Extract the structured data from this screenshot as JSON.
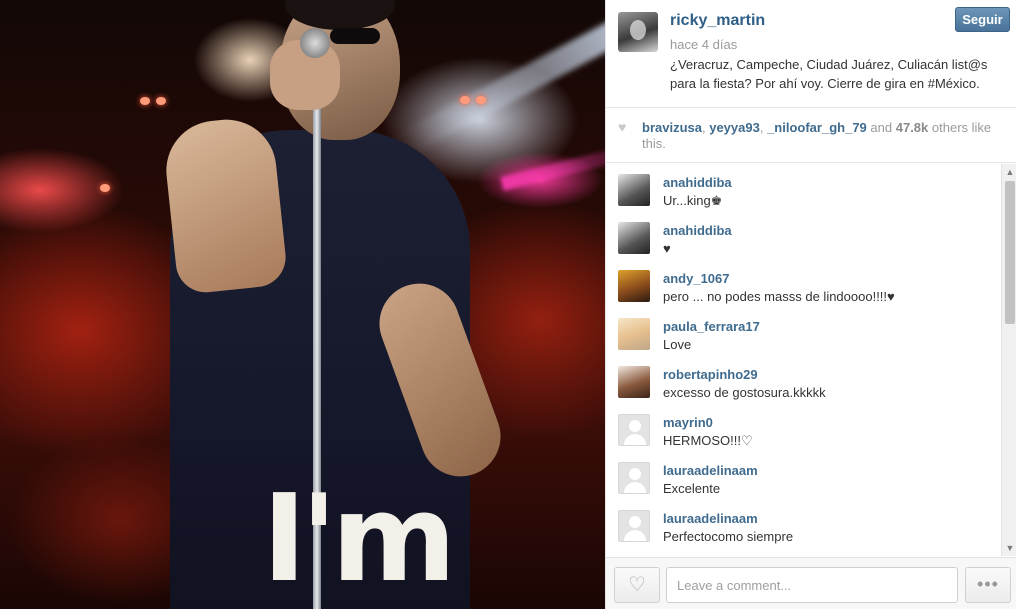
{
  "post": {
    "username": "ricky_martin",
    "time": "hace 4 días",
    "caption": "¿Veracruz, Campeche, Ciudad Juárez, Culiacán list@s para la fiesta? Por ahí voy. Cierre de gira en #México.",
    "follow_label": "Seguir",
    "photo_shirt_text": "I'm"
  },
  "likes": {
    "users": [
      "bravizusa",
      "yeyya93",
      "_niloofar_gh_79"
    ],
    "and": "and",
    "count": "47.8k",
    "suffix": "others like this."
  },
  "comments": [
    {
      "user": "anahiddiba",
      "text": "Ur...king♚",
      "avatar": "photo"
    },
    {
      "user": "anahiddiba",
      "text": "♥",
      "avatar": "photo"
    },
    {
      "user": "andy_1067",
      "text": "pero ... no podes masss de lindoooo!!!!♥",
      "avatar": "photo"
    },
    {
      "user": "paula_ferrara17",
      "text": "Love",
      "avatar": "photo"
    },
    {
      "user": "robertapinho29",
      "text": "excesso de gostosura.kkkkk",
      "avatar": "photo"
    },
    {
      "user": "mayrin0",
      "text": "HERMOSO!!!♡",
      "avatar": "blank"
    },
    {
      "user": "lauraadelinaam",
      "text": "Excelente",
      "avatar": "blank"
    },
    {
      "user": "lauraadelinaam",
      "text": "Perfectocomo siempre",
      "avatar": "blank"
    }
  ],
  "footer": {
    "comment_placeholder": "Leave a comment...",
    "heart_icon": "♡",
    "more_icon": "•••"
  },
  "colors": {
    "link": "#3f6b8f",
    "follow_button": "#5580a8"
  }
}
